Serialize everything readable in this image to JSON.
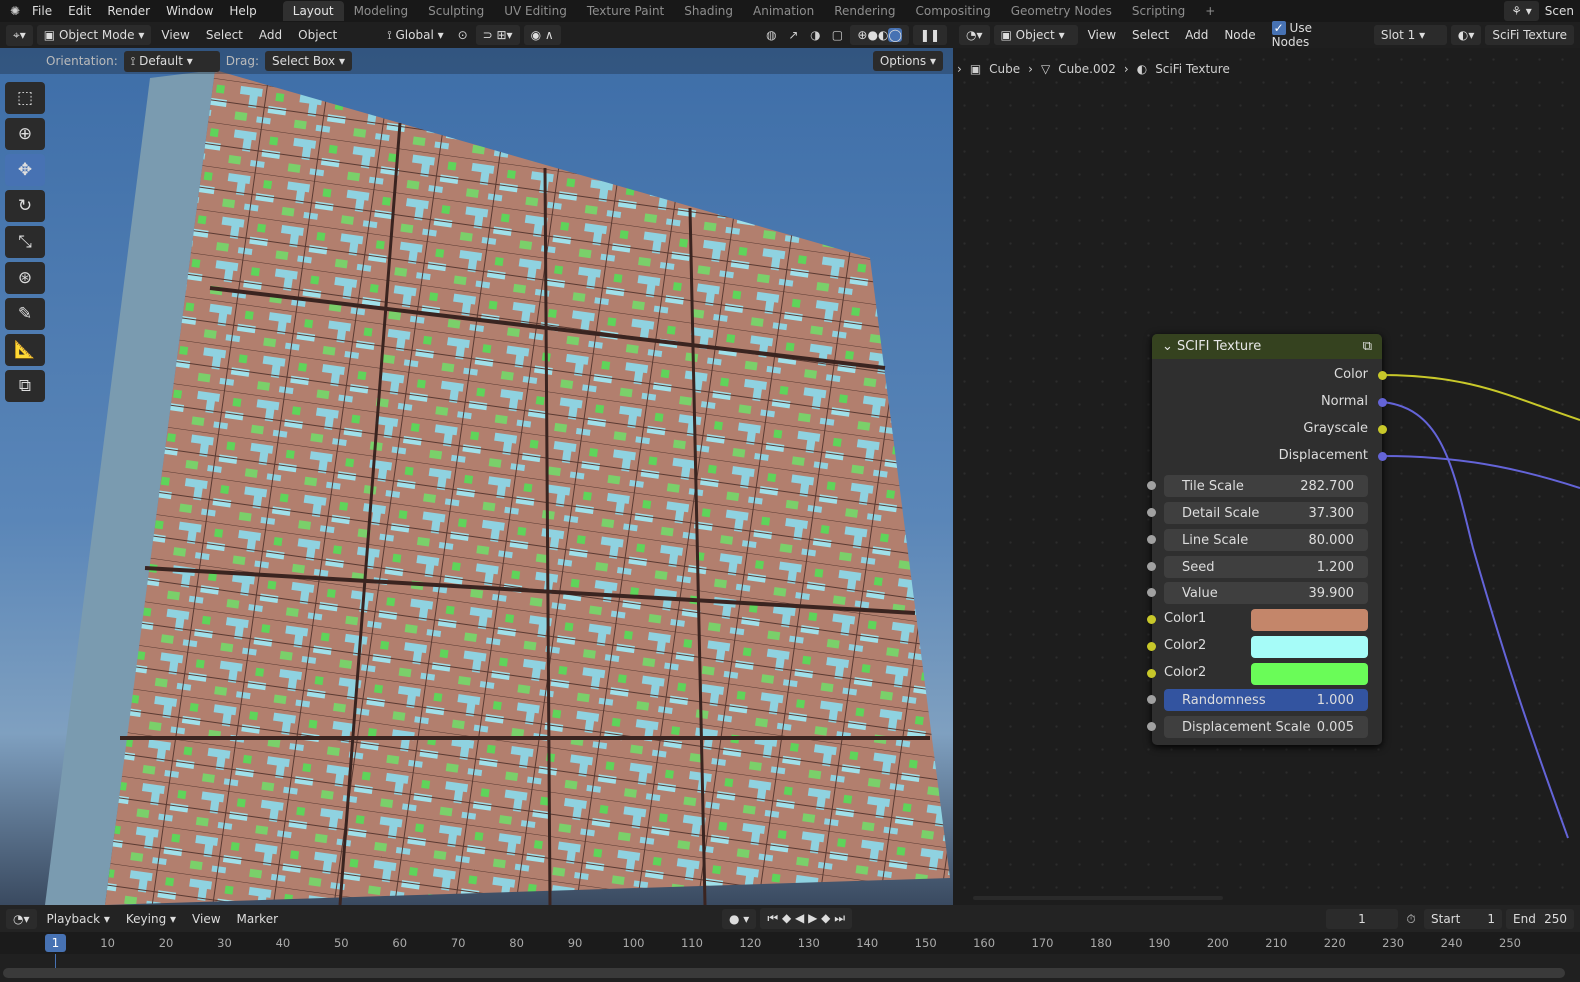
{
  "topbar": {
    "menus": [
      "File",
      "Edit",
      "Render",
      "Window",
      "Help"
    ],
    "workspaces": [
      "Layout",
      "Modeling",
      "Sculpting",
      "UV Editing",
      "Texture Paint",
      "Shading",
      "Animation",
      "Rendering",
      "Compositing",
      "Geometry Nodes",
      "Scripting"
    ],
    "active_workspace": "Layout",
    "add_label": "+",
    "scene": "Scen"
  },
  "viewport_header": {
    "mode": "Object Mode",
    "menus": [
      "View",
      "Select",
      "Add",
      "Object"
    ],
    "transform_orientation": "Global"
  },
  "tool_settings": {
    "orientation_label": "Orientation:",
    "orientation_value": "Default",
    "drag_label": "Drag:",
    "drag_value": "Select Box",
    "options_label": "Options"
  },
  "toolbar": {
    "tools": [
      "select-box",
      "cursor",
      "move",
      "rotate",
      "scale",
      "transform",
      "annotate",
      "measure",
      "add-cube"
    ],
    "active": "move"
  },
  "node_header": {
    "object": "Object",
    "menus": [
      "View",
      "Select",
      "Add",
      "Node"
    ],
    "use_nodes_label": "Use Nodes",
    "use_nodes": true,
    "slot": "Slot 1",
    "material": "SciFi Texture"
  },
  "breadcrumb": [
    "Cube",
    "Cube.002",
    "SciFi Texture"
  ],
  "node": {
    "title": "SCIFI Texture",
    "outputs": [
      {
        "label": "Color",
        "color": "#c8c82a"
      },
      {
        "label": "Normal",
        "color": "#6464d8"
      },
      {
        "label": "Grayscale",
        "color": "#c8c82a"
      },
      {
        "label": "Displacement",
        "color": "#6464d8"
      }
    ],
    "inputs": [
      {
        "label": "Tile Scale",
        "value": "282.700"
      },
      {
        "label": "Detail Scale",
        "value": "37.300"
      },
      {
        "label": "Line Scale",
        "value": "80.000"
      },
      {
        "label": "Seed",
        "value": "1.200"
      },
      {
        "label": "Value",
        "value": "39.900"
      }
    ],
    "colors": [
      {
        "label": "Color1",
        "swatch": "#c4866a"
      },
      {
        "label": "Color2",
        "swatch": "#a6fcf8"
      },
      {
        "label": "Color2",
        "swatch": "#6afc58"
      }
    ],
    "randomness": {
      "label": "Randomness",
      "value": "1.000"
    },
    "displacement_scale": {
      "label": "Displacement Scale",
      "value": "0.005"
    }
  },
  "timeline": {
    "menus": [
      "Playback",
      "Keying",
      "View",
      "Marker"
    ],
    "current_frame": "1",
    "start_label": "Start",
    "start": "1",
    "end_label": "End",
    "end": "250",
    "ticks": [
      "10",
      "20",
      "30",
      "40",
      "50",
      "60",
      "70",
      "80",
      "90",
      "100",
      "110",
      "120",
      "130",
      "140",
      "150",
      "160",
      "170",
      "180",
      "190",
      "200",
      "210",
      "220",
      "230",
      "240",
      "250"
    ],
    "playhead": "1"
  }
}
